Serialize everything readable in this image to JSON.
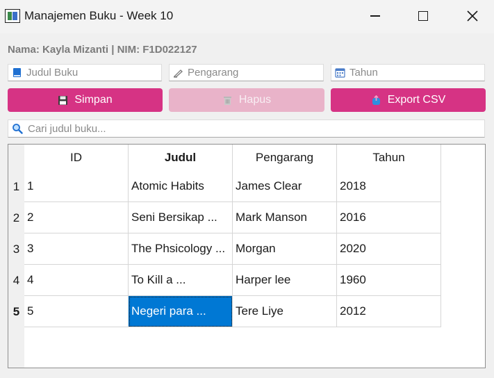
{
  "window": {
    "title": "Manajemen Buku - Week 10"
  },
  "header": {
    "student": "Nama: Kayla Mizanti | NIM: F1D022127"
  },
  "form": {
    "judul_placeholder": "Judul Buku",
    "pengarang_placeholder": "Pengarang",
    "tahun_placeholder": "Tahun"
  },
  "buttons": {
    "simpan": "Simpan",
    "hapus": "Hapus",
    "export": "Export CSV"
  },
  "search": {
    "placeholder": "Cari judul buku..."
  },
  "table": {
    "columns": [
      "ID",
      "Judul",
      "Pengarang",
      "Tahun"
    ],
    "row_numbers": [
      "1",
      "2",
      "3",
      "4",
      "5"
    ],
    "rows": [
      [
        "1",
        "Atomic Habits",
        "James Clear",
        "2018"
      ],
      [
        "2",
        "Seni Bersikap ...",
        "Mark Manson",
        "2016"
      ],
      [
        "3",
        "The Phsicology ...",
        "Morgan",
        "2020"
      ],
      [
        "4",
        "To Kill a ...",
        "Harper lee",
        "1960"
      ],
      [
        "5",
        "Negeri para ...",
        "Tere Liye",
        "2012"
      ]
    ],
    "selected": {
      "row": 5,
      "column": "Judul"
    }
  },
  "colors": {
    "accent": "#d63384",
    "accent_disabled": "#e9b3c9",
    "selection": "#0078d4"
  },
  "icons": {
    "app": "app-icon",
    "judul": "book-icon",
    "pengarang": "writing-hand-icon",
    "tahun": "calendar-icon",
    "simpan": "floppy-disk-icon",
    "hapus": "trash-icon",
    "export": "export-icon",
    "search": "magnifier-icon"
  }
}
